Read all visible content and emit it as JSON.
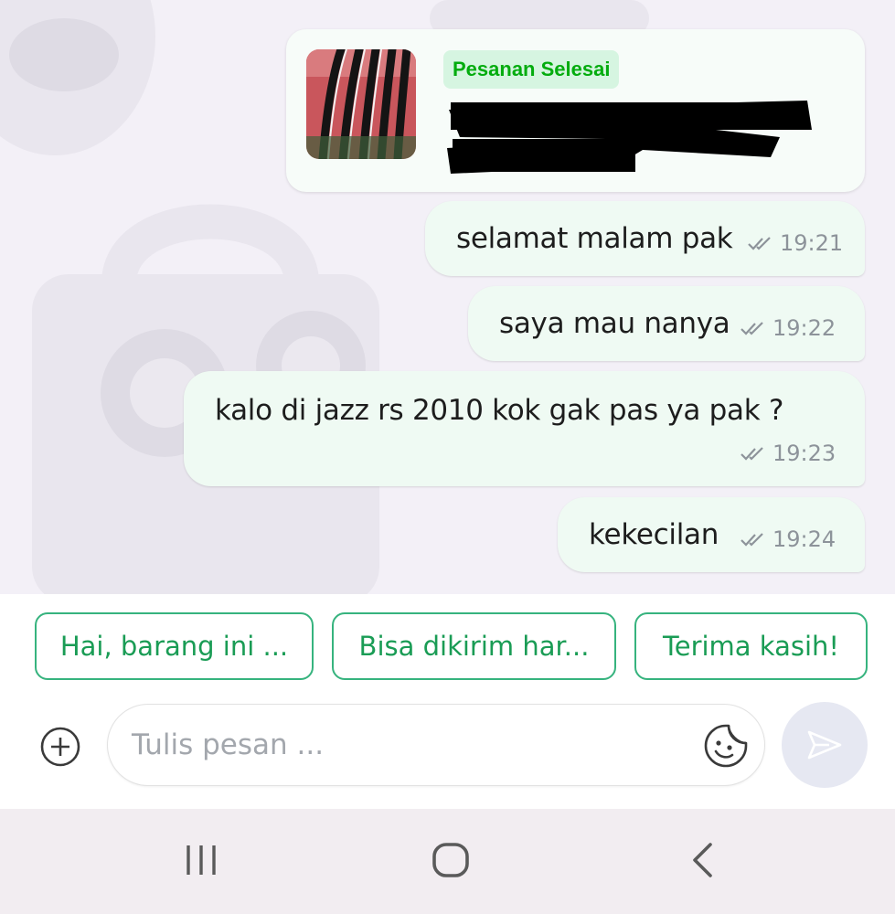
{
  "order_card": {
    "status_label": "Pesanan Selesai"
  },
  "messages": [
    {
      "text": "selamat malam pak",
      "time": "19:21"
    },
    {
      "text": "saya mau nanya",
      "time": "19:22"
    },
    {
      "text": "kalo di jazz rs 2010 kok gak pas ya pak ?",
      "time": "19:23"
    },
    {
      "text": "kekecilan",
      "time": "19:24"
    }
  ],
  "quick_replies": [
    "Hai, barang ini ...",
    "Bisa dikirim har...",
    "Terima kasih!"
  ],
  "composer": {
    "placeholder": "Tulis pesan ..."
  },
  "icons": {
    "attach": "plus-circle-icon",
    "sticker": "sticker-icon",
    "send": "send-icon",
    "read_status": "double-check-icon",
    "nav_recents": "recents-icon",
    "nav_home": "home-icon",
    "nav_back": "back-icon"
  },
  "colors": {
    "accent_green": "#03ac0e",
    "chip_border": "#36b37e",
    "bubble_bg": "#effaf3",
    "chat_bg": "#f3f0f7"
  }
}
